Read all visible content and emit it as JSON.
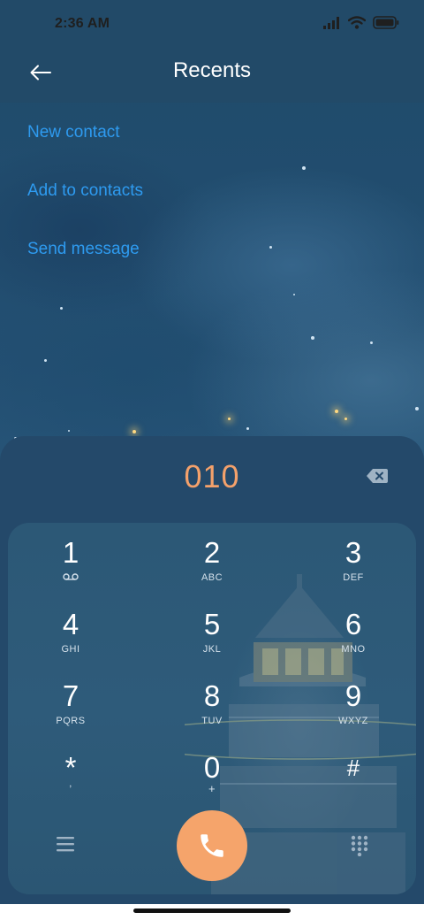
{
  "status_bar": {
    "time": "2:36 AM",
    "icons": [
      "signal-icon",
      "wifi-icon",
      "battery-icon"
    ]
  },
  "header": {
    "back_icon": "arrow-left-icon",
    "title": "Recents"
  },
  "actions": [
    {
      "label": "New contact"
    },
    {
      "label": "Add to contacts"
    },
    {
      "label": "Send message"
    }
  ],
  "dialer": {
    "number": "010",
    "backspace_icon": "backspace-icon",
    "keys": [
      {
        "digit": "1",
        "letters": "",
        "icon": "voicemail-icon"
      },
      {
        "digit": "2",
        "letters": "ABC"
      },
      {
        "digit": "3",
        "letters": "DEF"
      },
      {
        "digit": "4",
        "letters": "GHI"
      },
      {
        "digit": "5",
        "letters": "JKL"
      },
      {
        "digit": "6",
        "letters": "MNO"
      },
      {
        "digit": "7",
        "letters": "PQRS"
      },
      {
        "digit": "8",
        "letters": "TUV"
      },
      {
        "digit": "9",
        "letters": "WXYZ"
      },
      {
        "digit": "*",
        "letters": ","
      },
      {
        "digit": "0",
        "letters": "+"
      },
      {
        "digit": "#",
        "letters": ""
      }
    ],
    "menu_icon": "menu-icon",
    "call_icon": "phone-icon",
    "dialpad_icon": "dialpad-icon"
  },
  "colors": {
    "accent_link": "#2e9bf0",
    "number": "#f4a16b",
    "call_button": "#f5a46b"
  }
}
